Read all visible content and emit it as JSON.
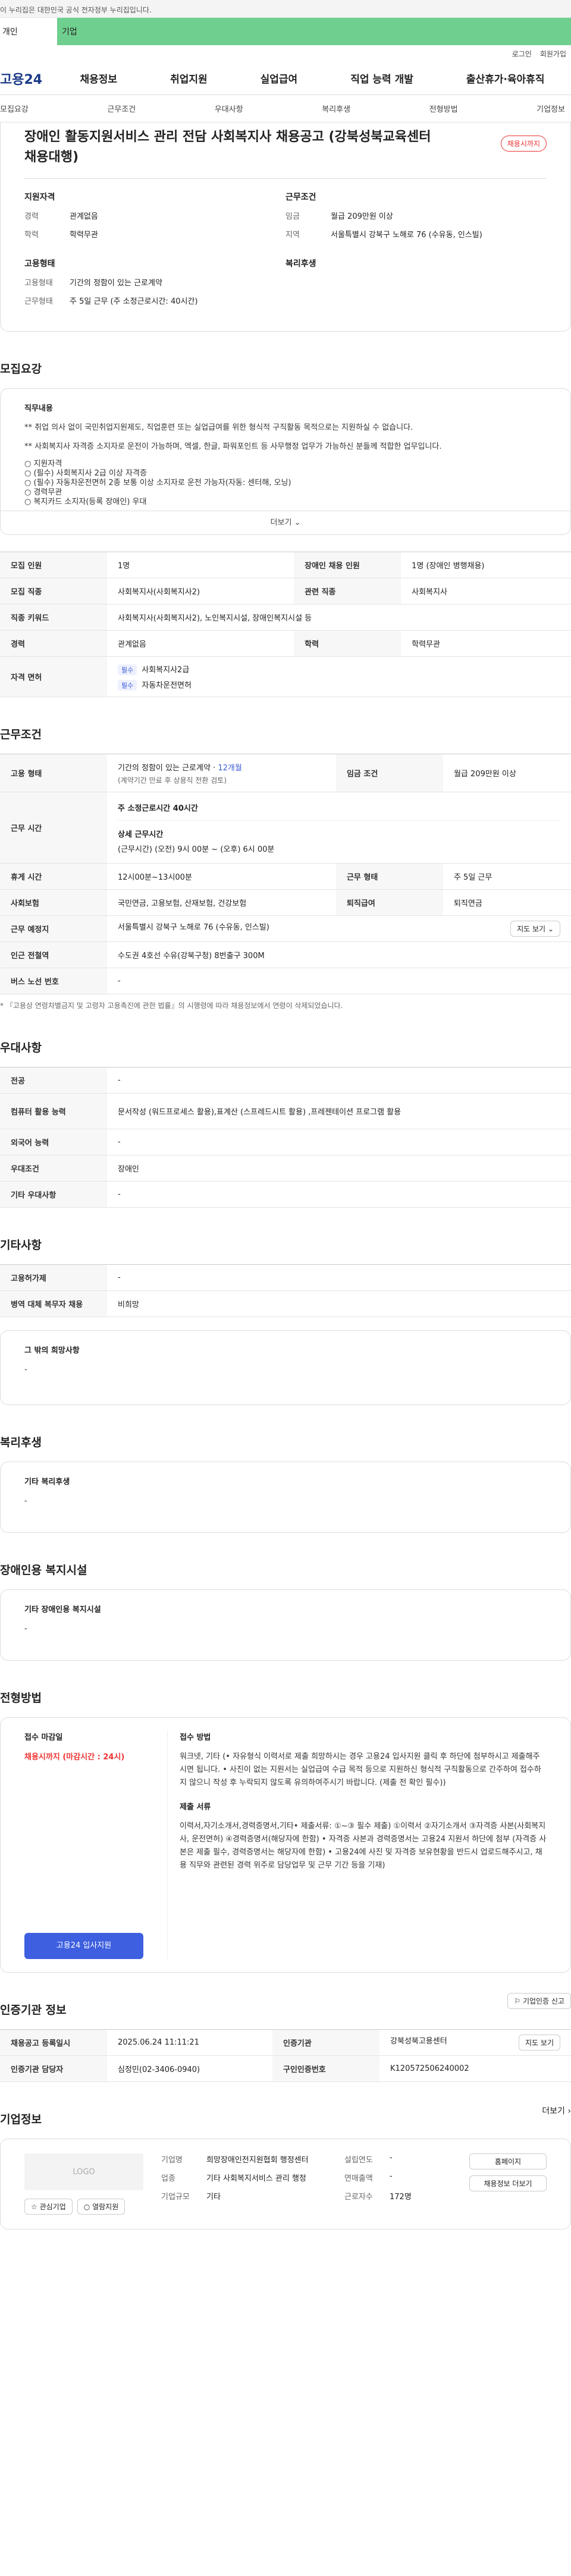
{
  "gov_notice": "이 누리집은 대한민국 공식 전자정부 누리집입니다.",
  "gov_tabs": [
    "개인",
    "기업"
  ],
  "util": [
    "로그인",
    "회원가입"
  ],
  "logo": "고용24",
  "gnb": [
    "채용정보",
    "취업지원",
    "실업급여",
    "직업 능력 개발",
    "출산휴가·육아휴직"
  ],
  "subnav": [
    "모집요강",
    "근무조건",
    "우대사항",
    "복리후생",
    "전형방법",
    "기업정보"
  ],
  "job": {
    "title": "장애인 활동지원서비스 관리 전담 사회복지사 채용공고 (강북성북교육센터 채용대행)",
    "status": "채용시까지",
    "qual_head": "지원자격",
    "qual": [
      {
        "k": "경력",
        "v": "관계없음"
      },
      {
        "k": "학력",
        "v": "학력무관"
      }
    ],
    "cond_head": "근무조건",
    "cond": [
      {
        "k": "임금",
        "v": "월급 209만원 이상"
      },
      {
        "k": "지역",
        "v": "서울특별시 강북구 노해로 76 (수유동, 인스빌)"
      }
    ],
    "emp_head": "고용형태",
    "emp": [
      {
        "k": "고용형태",
        "v": "기간의 정함이 있는 근로계약"
      },
      {
        "k": "근무형태",
        "v": "주 5일 근무 (주 소정근로시간: 40시간)"
      }
    ],
    "welfare_head": "복리후생"
  },
  "recruit": {
    "section": "모집요강",
    "duty_title": "직무내용",
    "lines": [
      "** 취업 의사 없이 국민취업지원제도, 직업훈련 또는 실업급여를 위한 형식적 구직활동 목적으로는 지원하실 수 없습니다.",
      "** 사회복지사 자격증 소지자로 운전이 가능하며, 엑셀, 한글, 파워포인트 등 사무행정 업무가 가능하신 분들께 적합한 업무입니다.",
      "○ 지원자격",
      "○ (필수) 사회복지사 2급 이상 자격증",
      "○ (필수) 자동차운전면허 2종 보통 이상 소지자로 운전 가능자(자동: 센터해, 오닝)",
      "○ 경력무관",
      "○ 복지카드 소지자(등록 장애인) 우대"
    ],
    "more": "더보기",
    "table": [
      {
        "k1": "모집 인원",
        "v1": "1명",
        "k2": "장애인 채용 인원",
        "v2": "1명 (장애인 병행채용)"
      },
      {
        "k1": "모집 직종",
        "v1": "사회복지사(사회복지사2)",
        "k2": "관련 직종",
        "v2": "사회복지사"
      },
      {
        "k1": "직종 키워드",
        "v1": "사회복지사(사회복지사2), 노인복지시설, 장애인복지시설 등"
      },
      {
        "k1": "경력",
        "v1": "관계없음",
        "k2": "학력",
        "v2": "학력무관"
      }
    ],
    "license_label": "자격 면허",
    "licenses": [
      {
        "tag": "필수",
        "name": "사회복지사2급"
      },
      {
        "tag": "필수",
        "name": "자동차운전면허"
      }
    ]
  },
  "work": {
    "section": "근무조건",
    "emp_label": "고용 형태",
    "emp_value": "기간의 정함이 있는 근로계약 ·",
    "emp_months": "12개월",
    "emp_note": "(계약기간 만료 후 상용직 전환 검토)",
    "wage_label": "임금 조건",
    "wage_value": "월급 209만원 이상",
    "hours_label": "근무 시간",
    "hours_main": "주 소정근로시간 40시간",
    "hours_detail_title": "상세 근무시간",
    "hours_detail": "(근무시간) (오전) 9시 00분 ~ (오후) 6시 00분",
    "rest_label": "휴게 시간",
    "rest_value": "12시00분~13시00분",
    "form_label": "근무 형태",
    "form_value": "주 5일 근무",
    "insure_label": "사회보험",
    "insure_value": "국민연금, 고용보험, 산재보험, 건강보험",
    "retire_label": "퇴직급여",
    "retire_value": "퇴직연금",
    "place_label": "근무 예정지",
    "place_value": "서울특별시 강북구 노해로 76 (수유동, 인스빌)",
    "map_btn": "지도 보기",
    "subway_label": "인근 전철역",
    "subway_value": "수도권 4호선 수유(강북구청) 8번출구 300M",
    "bus_label": "버스 노선 번호",
    "bus_value": "-",
    "note": "* 『고용상 연령차별금지 및 고령자 고용촉진에 관한 법률』의 시행령에 따라 채용정보에서 연령이 삭제되었습니다."
  },
  "pref": {
    "section": "우대사항",
    "rows": [
      {
        "k": "전공",
        "v": "-"
      },
      {
        "k": "컴퓨터 활용 능력",
        "v": "문서작성 (워드프로세스 활용),표계산 (스프레드시트 활용) ,프레젠테이션 프로그램 활용"
      },
      {
        "k": "외국어 능력",
        "v": "-"
      },
      {
        "k": "우대조건",
        "v": "장애인"
      },
      {
        "k": "기타 우대사항",
        "v": "-"
      }
    ]
  },
  "etc": {
    "section": "기타사항",
    "rows": [
      {
        "k": "고용허가제",
        "v": "-"
      },
      {
        "k": "병역 대체 복무자 채용",
        "v": "비희망"
      }
    ],
    "hope_title": "그 밖의 희망사항",
    "hope_value": "-"
  },
  "welfare": {
    "section": "복리후생",
    "title": "기타 복리후생",
    "value": "-"
  },
  "disabled": {
    "section": "장애인용 복지시설",
    "title": "기타 장애인용 복지시설",
    "value": "-"
  },
  "selection": {
    "section": "전형방법",
    "deadline_title": "접수 마감일",
    "deadline_value": "채용시까지 (마감시간 : 24시)",
    "apply_btn": "고용24 입사지원",
    "method_title": "접수 방법",
    "method_text": "워크넷, 기타 (• 자유형식 이력서로 제출 희망하시는 경우 고용24 입사지원 클릭 후 하단에 첨부하시고 제출해주시면 됩니다. • 사진이 없는 지원서는 실업급여 수급 목적 등으로 지원하신 형식적 구직활동으로 간주하여 접수하지 않으니 작성 후 누락되지 않도록 유의하여주시기 바랍니다. (제출 전 확인 필수))",
    "docs_title": "제출 서류",
    "docs_text": "이력서,자기소개서,경력증명서,기타• 제출서류: ①~③ 필수 제출) ①이력서 ②자기소개서 ③자격증 사본(사회복지사, 운전면허) ④경력증명서(해당자에 한함) • 자격증 사본과 경력증명서는 고용24 지원서 하단에 첨부 (자격증 사본은 제출 필수, 경력증명서는 해당자에 한함) • 고용24에 사진 및 자격증 보유현황을 반드시 업로드해주시고, 채용 직무와 관련된 경력 위주로 담당업무 및 근무 기간 등을 기재)"
  },
  "agency": {
    "section": "인증기관 정보",
    "btn": "기업인증 신고",
    "rows": [
      {
        "k1": "채용공고 등록일시",
        "v1": "2025.06.24 11:11:21",
        "k2": "인증기관",
        "v2": "강북성북고용센터",
        "btn": "지도 보기"
      },
      {
        "k1": "인증기관 담당자",
        "v1": "심정민(02-3406-0940)",
        "k2": "구인인증번호",
        "v2": "K120572506240002"
      }
    ]
  },
  "company": {
    "section": "기업정보",
    "more": "더보기",
    "logo": "LOGO",
    "fav": "관심기업",
    "rec": "열람지원",
    "rows": [
      {
        "k": "기업명",
        "v": "희망장애인전지원협회 행정센터"
      },
      {
        "k": "업종",
        "v": "기타 사회복지서비스 관리 행정"
      },
      {
        "k": "기업규모",
        "v": "기타"
      }
    ],
    "rows2": [
      {
        "k": "설립연도",
        "v": "-"
      },
      {
        "k": "연매출액",
        "v": "-"
      },
      {
        "k": "근로자수",
        "v": "172명"
      }
    ],
    "btn1": "홈페이지",
    "btn2": "채용정보 더보기"
  }
}
